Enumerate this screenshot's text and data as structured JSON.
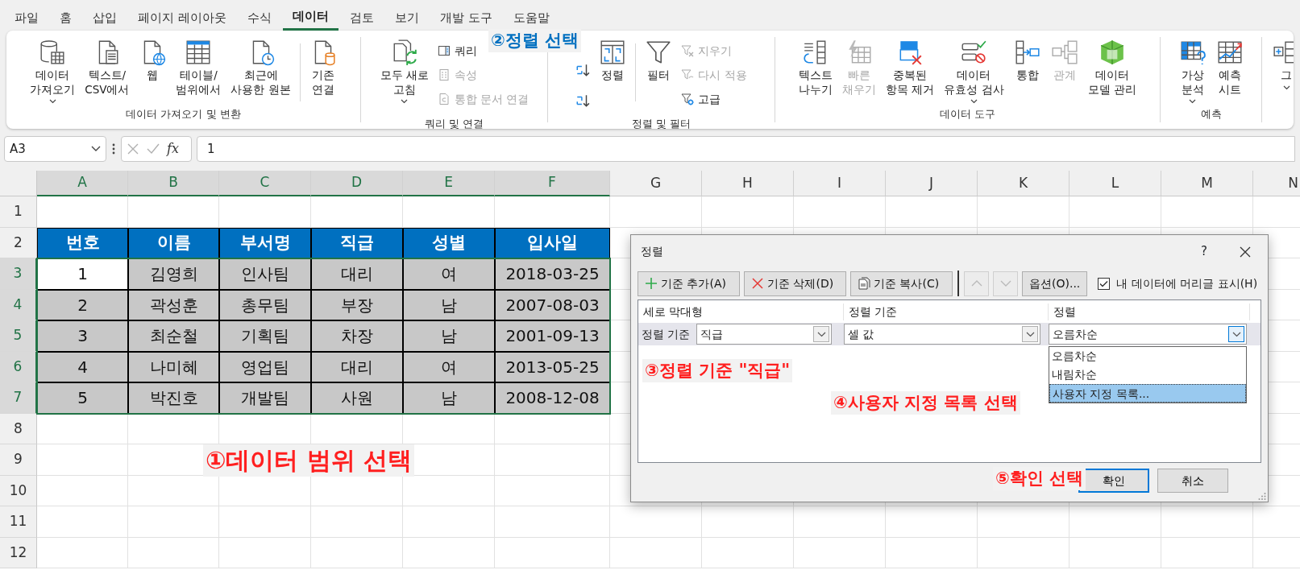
{
  "tabs": [
    {
      "label": "파일",
      "selected": false
    },
    {
      "label": "홈",
      "selected": false
    },
    {
      "label": "삽입",
      "selected": false
    },
    {
      "label": "페이지 레이아웃",
      "selected": false
    },
    {
      "label": "수식",
      "selected": false
    },
    {
      "label": "데이터",
      "selected": true
    },
    {
      "label": "검토",
      "selected": false
    },
    {
      "label": "보기",
      "selected": false
    },
    {
      "label": "개발 도구",
      "selected": false
    },
    {
      "label": "도움말",
      "selected": false
    }
  ],
  "ribbon_groups": [
    {
      "label": "데이터 가져오기 및 변환",
      "buttons": [
        {
          "kind": "large",
          "label": "데이터\n가져오기",
          "dropdown": true,
          "disabled": false
        },
        {
          "kind": "large",
          "label": "텍스트/\nCSV에서",
          "dropdown": false,
          "disabled": false
        },
        {
          "kind": "large",
          "label": "웹",
          "dropdown": false,
          "disabled": false
        },
        {
          "kind": "large",
          "label": "테이블/\n범위에서",
          "dropdown": false,
          "disabled": false
        },
        {
          "kind": "large",
          "label": "최근에\n사용한 원본",
          "dropdown": false,
          "disabled": false
        },
        {
          "kind": "separator"
        },
        {
          "kind": "large",
          "label": "기존\n연결",
          "dropdown": false,
          "disabled": false
        }
      ]
    },
    {
      "label": "쿼리 및 연결",
      "buttons": [
        {
          "kind": "large",
          "label": "모두 새로\n고침",
          "dropdown": true,
          "disabled": false
        },
        {
          "kind": "small",
          "label": "쿼리",
          "disabled": false
        },
        {
          "kind": "small",
          "label": "속성",
          "disabled": true
        },
        {
          "kind": "small",
          "label": "통합 문서 연결",
          "disabled": true
        }
      ]
    },
    {
      "label": "정렬 및 필터",
      "buttons": [
        {
          "kind": "icon",
          "disabled": false
        },
        {
          "kind": "icon",
          "disabled": false
        },
        {
          "kind": "large",
          "label": "정렬",
          "dropdown": false,
          "disabled": false
        },
        {
          "kind": "separator"
        },
        {
          "kind": "large",
          "label": "필터",
          "dropdown": false,
          "disabled": false
        },
        {
          "kind": "small",
          "label": "지우기",
          "disabled": true
        },
        {
          "kind": "small",
          "label": "다시 적용",
          "disabled": true
        },
        {
          "kind": "small",
          "label": "고급",
          "disabled": false
        }
      ]
    },
    {
      "label": "데이터 도구",
      "buttons": [
        {
          "kind": "large",
          "label": "텍스트\n나누기",
          "dropdown": false,
          "disabled": false
        },
        {
          "kind": "large",
          "label": "빠른\n채우기",
          "dropdown": false,
          "disabled": true
        },
        {
          "kind": "large",
          "label": "중복된\n항목 제거",
          "dropdown": false,
          "disabled": false
        },
        {
          "kind": "large",
          "label": "데이터\n유효성 검사",
          "dropdown": true,
          "disabled": false
        },
        {
          "kind": "large",
          "label": "통합",
          "dropdown": false,
          "disabled": false
        },
        {
          "kind": "large",
          "label": "관계",
          "dropdown": false,
          "disabled": true
        },
        {
          "kind": "large",
          "label": "데이터\n모델 관리",
          "dropdown": false,
          "disabled": false
        }
      ]
    },
    {
      "label": "예측",
      "buttons": [
        {
          "kind": "large",
          "label": "가상\n분석",
          "dropdown": true,
          "disabled": false
        },
        {
          "kind": "large",
          "label": "예측\n시트",
          "dropdown": false,
          "disabled": false
        }
      ]
    },
    {
      "buttons": [
        {
          "kind": "large",
          "label": "그",
          "dropdown": true,
          "disabled": false
        }
      ]
    }
  ],
  "formula_bar": {
    "name_box": "A3",
    "function_button": "fx",
    "value": "1"
  },
  "sheet": {
    "columns": [
      {
        "label": "A",
        "selected": true
      },
      {
        "label": "B",
        "selected": true
      },
      {
        "label": "C",
        "selected": true
      },
      {
        "label": "D",
        "selected": true
      },
      {
        "label": "E",
        "selected": true
      },
      {
        "label": "F",
        "selected": true
      },
      {
        "label": "G",
        "selected": false
      },
      {
        "label": "H",
        "selected": false
      },
      {
        "label": "I",
        "selected": false
      },
      {
        "label": "J",
        "selected": false
      },
      {
        "label": "K",
        "selected": false
      },
      {
        "label": "L",
        "selected": false
      },
      {
        "label": "M",
        "selected": false
      },
      {
        "label": "N",
        "selected": false
      }
    ],
    "rows": [
      {
        "number": "1",
        "selected": false,
        "cells": []
      },
      {
        "number": "2",
        "selected": false,
        "cells": [
          {
            "text": "번호",
            "kind": "header"
          },
          {
            "text": "이름",
            "kind": "header"
          },
          {
            "text": "부서명",
            "kind": "header"
          },
          {
            "text": "직급",
            "kind": "header"
          },
          {
            "text": "성별",
            "kind": "header"
          },
          {
            "text": "입사일",
            "kind": "header"
          }
        ]
      },
      {
        "number": "3",
        "selected": true,
        "cells": [
          {
            "text": "1",
            "kind": "data",
            "active": true
          },
          {
            "text": "김영희",
            "kind": "data",
            "active": false
          },
          {
            "text": "인사팀",
            "kind": "data",
            "active": false
          },
          {
            "text": "대리",
            "kind": "data",
            "active": false
          },
          {
            "text": "여",
            "kind": "data",
            "active": false
          },
          {
            "text": "2018-03-25",
            "kind": "data",
            "active": false
          }
        ]
      },
      {
        "number": "4",
        "selected": true,
        "cells": [
          {
            "text": "2",
            "kind": "data",
            "active": false
          },
          {
            "text": "곽성훈",
            "kind": "data",
            "active": false
          },
          {
            "text": "총무팀",
            "kind": "data",
            "active": false
          },
          {
            "text": "부장",
            "kind": "data",
            "active": false
          },
          {
            "text": "남",
            "kind": "data",
            "active": false
          },
          {
            "text": "2007-08-03",
            "kind": "data",
            "active": false
          }
        ]
      },
      {
        "number": "5",
        "selected": true,
        "cells": [
          {
            "text": "3",
            "kind": "data",
            "active": false
          },
          {
            "text": "최순철",
            "kind": "data",
            "active": false
          },
          {
            "text": "기획팀",
            "kind": "data",
            "active": false
          },
          {
            "text": "차장",
            "kind": "data",
            "active": false
          },
          {
            "text": "남",
            "kind": "data",
            "active": false
          },
          {
            "text": "2001-09-13",
            "kind": "data",
            "active": false
          }
        ]
      },
      {
        "number": "6",
        "selected": true,
        "cells": [
          {
            "text": "4",
            "kind": "data",
            "active": false
          },
          {
            "text": "나미혜",
            "kind": "data",
            "active": false
          },
          {
            "text": "영업팀",
            "kind": "data",
            "active": false
          },
          {
            "text": "대리",
            "kind": "data",
            "active": false
          },
          {
            "text": "여",
            "kind": "data",
            "active": false
          },
          {
            "text": "2013-05-25",
            "kind": "data",
            "active": false
          }
        ]
      },
      {
        "number": "7",
        "selected": true,
        "cells": [
          {
            "text": "5",
            "kind": "data",
            "active": false
          },
          {
            "text": "박진호",
            "kind": "data",
            "active": false
          },
          {
            "text": "개발팀",
            "kind": "data",
            "active": false
          },
          {
            "text": "사원",
            "kind": "data",
            "active": false
          },
          {
            "text": "남",
            "kind": "data",
            "active": false
          },
          {
            "text": "2008-12-08",
            "kind": "data",
            "active": false
          }
        ]
      },
      {
        "number": "8",
        "selected": false,
        "cells": []
      },
      {
        "number": "9",
        "selected": false,
        "cells": []
      },
      {
        "number": "10",
        "selected": false,
        "cells": []
      },
      {
        "number": "11",
        "selected": false,
        "cells": []
      },
      {
        "number": "12",
        "selected": false,
        "cells": []
      }
    ]
  },
  "sort_dialog": {
    "title": "정렬",
    "help": "?",
    "toolbar": [
      {
        "kind": "add",
        "label": "기준 추가(A)",
        "disabled": false
      },
      {
        "kind": "delete",
        "label": "기준 삭제(D)",
        "disabled": false
      },
      {
        "kind": "copy",
        "label": "기준 복사(C)",
        "disabled": false
      },
      {
        "kind": "up",
        "disabled": true
      },
      {
        "kind": "down",
        "disabled": true
      },
      {
        "kind": "text",
        "label": "옵션(O)...",
        "disabled": false
      }
    ],
    "header_checkbox": {
      "label": "내 데이터에 머리글 표시(H)",
      "checked": true
    },
    "columns": [
      "세로 막대형",
      "정렬 기준",
      "정렬"
    ],
    "criteria": [
      {
        "label": "정렬 기준",
        "column": "직급",
        "sort_on": "셀 값",
        "order": "오름차순",
        "order_open": true
      }
    ],
    "order_options": [
      {
        "label": "오름차순",
        "selected": false
      },
      {
        "label": "내림차순",
        "selected": false
      },
      {
        "label": "사용자 지정 목록...",
        "selected": true
      }
    ],
    "buttons": [
      {
        "label": "확인",
        "default": true
      },
      {
        "label": "취소",
        "default": false
      }
    ]
  },
  "annotations": [
    {
      "text": "①데이터 범위 선택",
      "color": "#ff1f1f"
    },
    {
      "text": "②정렬 선택",
      "color": "#0070c0"
    },
    {
      "text": "③정렬 기준 \"직급\"",
      "color": "#ff1f1f"
    },
    {
      "text": "④사용자 지정 목록 선택",
      "color": "#ff1f1f"
    },
    {
      "text": "⑤확인 선택",
      "color": "#ff1f1f"
    }
  ]
}
